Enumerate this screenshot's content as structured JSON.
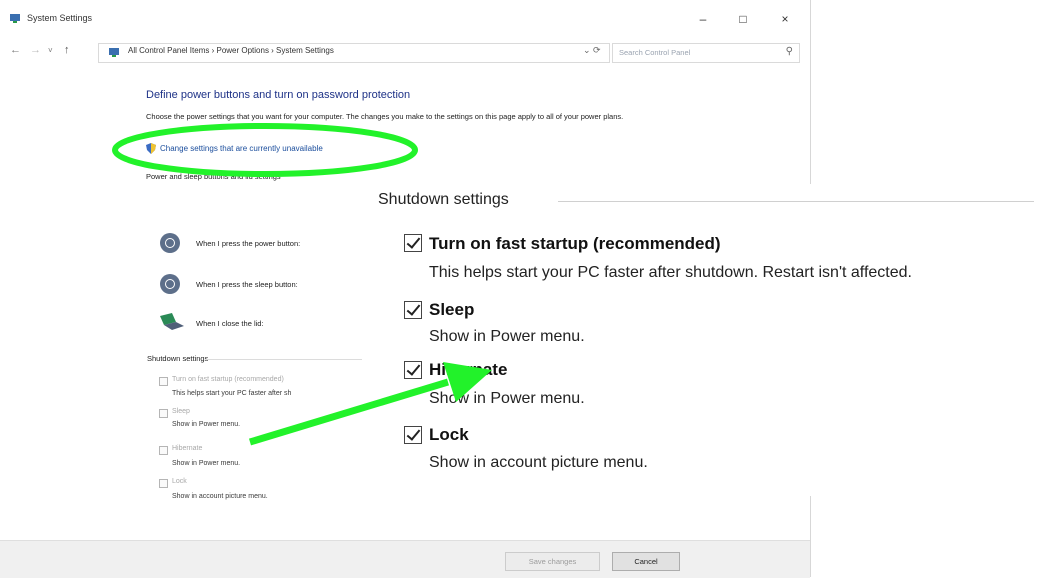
{
  "window": {
    "title": "System Settings",
    "controls": {
      "minimize": "–",
      "maximize": "□",
      "close": "×"
    }
  },
  "address": {
    "breadcrumb": "All Control Panel Items  ›  Power Options  ›  System Settings",
    "search_placeholder": "Search Control Panel"
  },
  "content": {
    "heading": "Define power buttons and turn on password protection",
    "description": "Choose the power settings that you want for your computer. The changes you make to the settings on this page apply to all of your power plans.",
    "change_link": "Change settings that are currently unavailable",
    "sub_heading": "Power and sleep buttons and lid settings",
    "options": [
      {
        "label": "When I press the power button:",
        "icon": "power-button-icon"
      },
      {
        "label": "When I press the sleep button:",
        "icon": "sleep-button-icon"
      },
      {
        "label": "When I close the lid:",
        "icon": "laptop-lid-icon"
      }
    ],
    "shutdown_small": {
      "heading": "Shutdown settings",
      "items": [
        {
          "title": "Turn on fast startup (recommended)",
          "desc": "This helps start your PC faster after sh"
        },
        {
          "title": "Sleep",
          "desc": "Show in Power menu."
        },
        {
          "title": "Hibernate",
          "desc": "Show in Power menu."
        },
        {
          "title": "Lock",
          "desc": "Show in account picture menu."
        }
      ]
    }
  },
  "footer": {
    "save": "Save changes",
    "cancel": "Cancel"
  },
  "zoom": {
    "heading": "Shutdown settings",
    "items": [
      {
        "title": "Turn on fast startup (recommended)",
        "desc": "This helps start your PC faster after shutdown. Restart isn't affected.",
        "checked": true
      },
      {
        "title": "Sleep",
        "desc": "Show in Power menu.",
        "checked": true
      },
      {
        "title": "Hibernate",
        "desc": "Show in Power menu.",
        "checked": true
      },
      {
        "title": "Lock",
        "desc": "Show in account picture menu.",
        "checked": true
      }
    ]
  },
  "colors": {
    "heading_blue": "#1e3287",
    "link_blue": "#1a4d9c",
    "annotation_green": "#22f22a"
  }
}
